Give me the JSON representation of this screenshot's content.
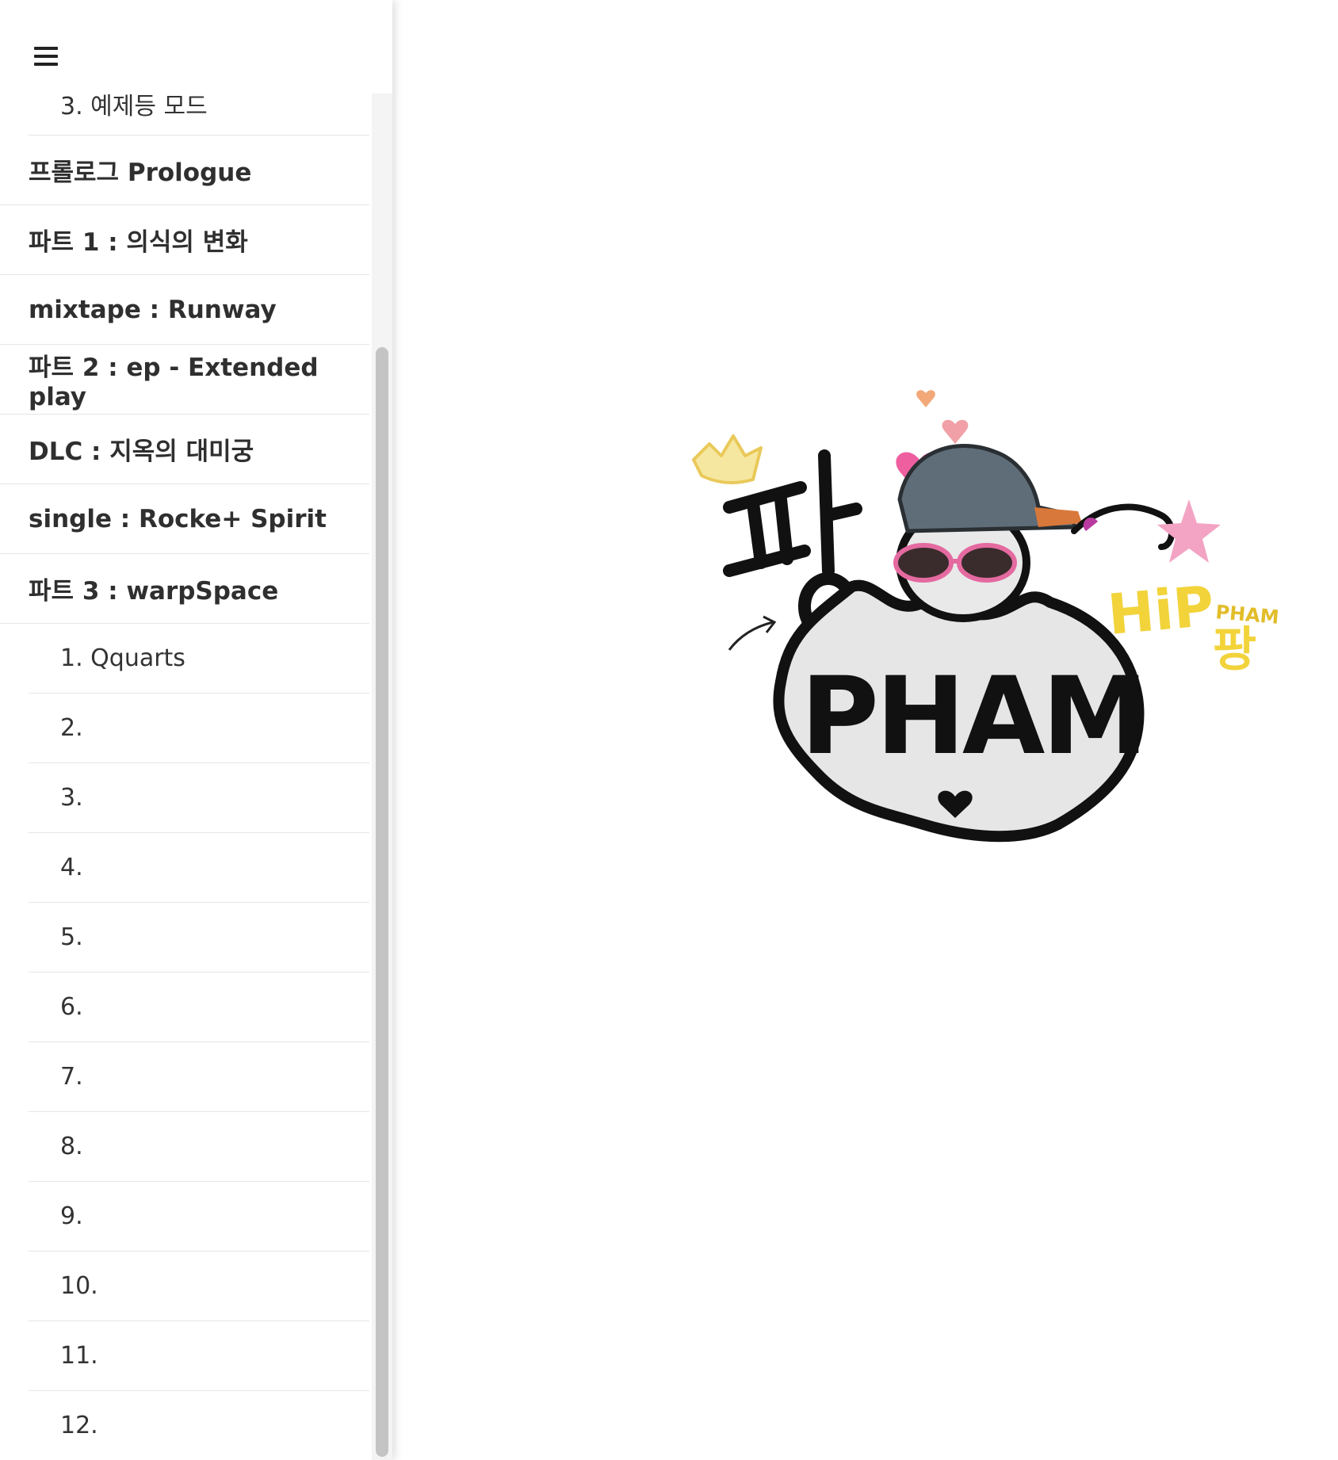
{
  "sidebar": {
    "menu_icon": "hamburger-menu-icon",
    "items": [
      {
        "label": "3. 예제등 모드",
        "level": "sub"
      },
      {
        "label": "프롤로그 Prologue",
        "level": "top"
      },
      {
        "label": "파트 1 : 의식의 변화",
        "level": "top"
      },
      {
        "label": "mixtape : Runway",
        "level": "top"
      },
      {
        "label": "파트 2 : ep - Extended play",
        "level": "top"
      },
      {
        "label": "DLC : 지옥의 대미궁",
        "level": "top"
      },
      {
        "label": "single : Rocke+ Spirit",
        "level": "top"
      },
      {
        "label": "파트 3 : warpSpace",
        "level": "top"
      },
      {
        "label": "1. Qquarts",
        "level": "sub"
      },
      {
        "label": "2.",
        "level": "sub"
      },
      {
        "label": "3.",
        "level": "sub"
      },
      {
        "label": "4.",
        "level": "sub"
      },
      {
        "label": "5.",
        "level": "sub"
      },
      {
        "label": "6.",
        "level": "sub"
      },
      {
        "label": "7.",
        "level": "sub"
      },
      {
        "label": "8.",
        "level": "sub"
      },
      {
        "label": "9.",
        "level": "sub"
      },
      {
        "label": "10.",
        "level": "sub"
      },
      {
        "label": "11.",
        "level": "sub"
      },
      {
        "label": "12.",
        "level": "sub"
      }
    ]
  },
  "main": {
    "logo": {
      "text_korean": "팡",
      "text_main": "PHAM",
      "text_hip": "HiP",
      "text_small": "PHAM",
      "text_small_korean": "팡"
    }
  },
  "colors": {
    "text": "#333333",
    "divider": "#e6e6e6",
    "scroll_thumb": "#c4c4c4",
    "logo_yellow": "#f2d33a",
    "logo_pink": "#ee5fa0",
    "logo_cap": "#5f6d78"
  }
}
